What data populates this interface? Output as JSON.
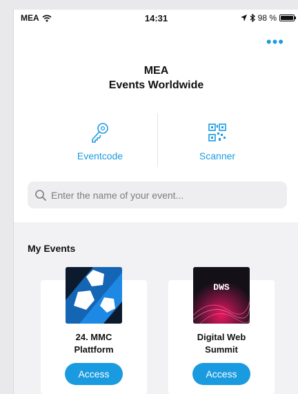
{
  "status_bar": {
    "carrier": "MEA",
    "time": "14:31",
    "battery": "98 %",
    "battery_level": 0.98,
    "icons": [
      "wifi-icon",
      "location-arrow-icon",
      "bluetooth-icon",
      "battery-icon"
    ]
  },
  "header": {
    "more_icon": "more-dots-icon",
    "title_line1": "MEA",
    "title_line2": "Events Worldwide"
  },
  "actions": {
    "eventcode_label": "Eventcode",
    "eventcode_icon": "key-icon",
    "scanner_label": "Scanner",
    "scanner_icon": "qr-code-icon"
  },
  "search": {
    "placeholder": "Enter the name of your event...",
    "value": ""
  },
  "my_events": {
    "title": "My Events",
    "events": [
      {
        "name_line1": "24. MMC",
        "name_line2": "Plattform",
        "button": "Access"
      },
      {
        "name_line1": "Digital Web",
        "name_line2": "Summit",
        "thumb_text": "DWS",
        "button": "Access"
      }
    ]
  },
  "colors": {
    "accent": "#1a9be0",
    "section_bg": "#f2f2f5",
    "search_bg": "#eeeef0"
  }
}
